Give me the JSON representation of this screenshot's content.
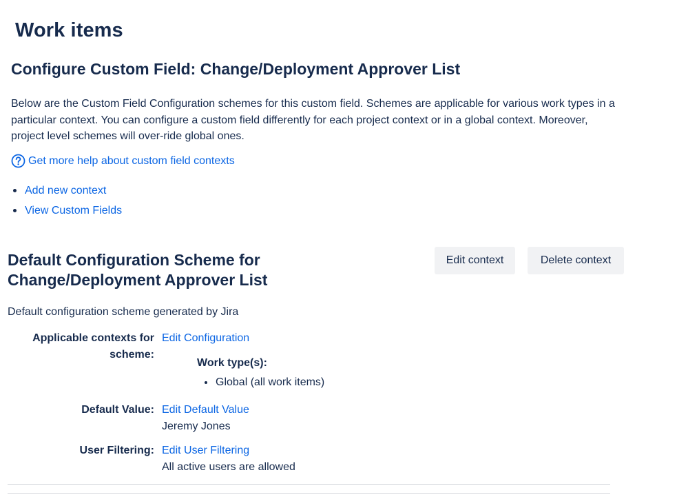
{
  "page": {
    "title": "Work items",
    "subtitle": "Configure Custom Field: Change/Deployment Approver List",
    "description": "Below are the Custom Field Configuration schemes for this custom field. Schemes are applicable for various work types in a particular context. You can configure a custom field differently for each project context or in a global context. Moreover, project level schemes will over-ride global ones.",
    "help_link": "Get more help about custom field contexts",
    "actions": [
      {
        "label": "Add new context"
      },
      {
        "label": "View Custom Fields"
      }
    ]
  },
  "scheme": {
    "title": "Default Configuration Scheme for Change/Deployment Approver List",
    "edit_button": "Edit context",
    "delete_button": "Delete context",
    "description": "Default configuration scheme generated by Jira",
    "applicable_contexts": {
      "label": "Applicable contexts for scheme:",
      "link": "Edit Configuration",
      "work_types_heading": "Work type(s):",
      "work_types": [
        "Global (all work items)"
      ]
    },
    "default_value": {
      "label": "Default Value:",
      "link": "Edit Default Value",
      "value": "Jeremy Jones"
    },
    "user_filtering": {
      "label": "User Filtering:",
      "link": "Edit User Filtering",
      "value": "All active users are allowed"
    }
  },
  "theme": {
    "text": "#172b4d",
    "link": "#0c66e4",
    "button_bg": "#f1f2f4",
    "divider": "#d5d8dd"
  },
  "icons": {
    "help": "question-circle-icon"
  }
}
